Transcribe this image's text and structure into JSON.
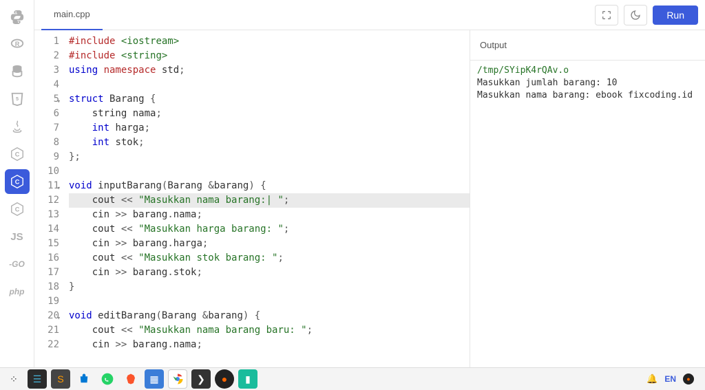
{
  "tab_filename": "main.cpp",
  "run_label": "Run",
  "output_header": "Output",
  "output_path": "/tmp/SYipK4rQAv.o",
  "output_lines": [
    "Masukkan jumlah barang: 10",
    "Masukkan nama barang: ebook fixcoding.id"
  ],
  "highlighted_line": 12,
  "code_lines": [
    {
      "n": 1,
      "fold": false,
      "tokens": [
        {
          "t": "#include",
          "c": "kw-red"
        },
        {
          "t": " "
        },
        {
          "t": "<iostream>",
          "c": "kw-green"
        }
      ]
    },
    {
      "n": 2,
      "fold": false,
      "tokens": [
        {
          "t": "#include",
          "c": "kw-red"
        },
        {
          "t": " "
        },
        {
          "t": "<string>",
          "c": "kw-green"
        }
      ]
    },
    {
      "n": 3,
      "fold": false,
      "tokens": [
        {
          "t": "using ",
          "c": "kw-blue"
        },
        {
          "t": "namespace ",
          "c": "kw-red"
        },
        {
          "t": "std"
        },
        {
          "t": ";",
          "c": "op"
        }
      ]
    },
    {
      "n": 4,
      "fold": false,
      "tokens": [
        {
          "t": " "
        }
      ]
    },
    {
      "n": 5,
      "fold": true,
      "tokens": [
        {
          "t": "struct ",
          "c": "kw-blue"
        },
        {
          "t": "Barang "
        },
        {
          "t": "{",
          "c": "op"
        }
      ]
    },
    {
      "n": 6,
      "fold": false,
      "tokens": [
        {
          "t": "    string nama"
        },
        {
          "t": ";",
          "c": "op"
        }
      ]
    },
    {
      "n": 7,
      "fold": false,
      "tokens": [
        {
          "t": "    "
        },
        {
          "t": "int ",
          "c": "kw-blue"
        },
        {
          "t": "harga"
        },
        {
          "t": ";",
          "c": "op"
        }
      ]
    },
    {
      "n": 8,
      "fold": false,
      "tokens": [
        {
          "t": "    "
        },
        {
          "t": "int ",
          "c": "kw-blue"
        },
        {
          "t": "stok"
        },
        {
          "t": ";",
          "c": "op"
        }
      ]
    },
    {
      "n": 9,
      "fold": false,
      "tokens": [
        {
          "t": "};",
          "c": "op"
        }
      ]
    },
    {
      "n": 10,
      "fold": false,
      "tokens": [
        {
          "t": " "
        }
      ]
    },
    {
      "n": 11,
      "fold": true,
      "tokens": [
        {
          "t": "void ",
          "c": "kw-blue"
        },
        {
          "t": "inputBarang"
        },
        {
          "t": "(",
          "c": "op"
        },
        {
          "t": "Barang "
        },
        {
          "t": "&",
          "c": "op"
        },
        {
          "t": "barang"
        },
        {
          "t": ") {",
          "c": "op"
        }
      ]
    },
    {
      "n": 12,
      "fold": false,
      "tokens": [
        {
          "t": "    cout "
        },
        {
          "t": "<<",
          "c": "op"
        },
        {
          "t": " "
        },
        {
          "t": "\"Masukkan nama barang:| \"",
          "c": "str"
        },
        {
          "t": ";",
          "c": "op"
        }
      ]
    },
    {
      "n": 13,
      "fold": false,
      "tokens": [
        {
          "t": "    cin "
        },
        {
          "t": ">>",
          "c": "op"
        },
        {
          "t": " barang"
        },
        {
          "t": ".",
          "c": "op"
        },
        {
          "t": "nama"
        },
        {
          "t": ";",
          "c": "op"
        }
      ]
    },
    {
      "n": 14,
      "fold": false,
      "tokens": [
        {
          "t": "    cout "
        },
        {
          "t": "<<",
          "c": "op"
        },
        {
          "t": " "
        },
        {
          "t": "\"Masukkan harga barang: \"",
          "c": "str"
        },
        {
          "t": ";",
          "c": "op"
        }
      ]
    },
    {
      "n": 15,
      "fold": false,
      "tokens": [
        {
          "t": "    cin "
        },
        {
          "t": ">>",
          "c": "op"
        },
        {
          "t": " barang"
        },
        {
          "t": ".",
          "c": "op"
        },
        {
          "t": "harga"
        },
        {
          "t": ";",
          "c": "op"
        }
      ]
    },
    {
      "n": 16,
      "fold": false,
      "tokens": [
        {
          "t": "    cout "
        },
        {
          "t": "<<",
          "c": "op"
        },
        {
          "t": " "
        },
        {
          "t": "\"Masukkan stok barang: \"",
          "c": "str"
        },
        {
          "t": ";",
          "c": "op"
        }
      ]
    },
    {
      "n": 17,
      "fold": false,
      "tokens": [
        {
          "t": "    cin "
        },
        {
          "t": ">>",
          "c": "op"
        },
        {
          "t": " barang"
        },
        {
          "t": ".",
          "c": "op"
        },
        {
          "t": "stok"
        },
        {
          "t": ";",
          "c": "op"
        }
      ]
    },
    {
      "n": 18,
      "fold": false,
      "tokens": [
        {
          "t": "}",
          "c": "op"
        }
      ]
    },
    {
      "n": 19,
      "fold": false,
      "tokens": [
        {
          "t": " "
        }
      ]
    },
    {
      "n": 20,
      "fold": true,
      "tokens": [
        {
          "t": "void ",
          "c": "kw-blue"
        },
        {
          "t": "editBarang"
        },
        {
          "t": "(",
          "c": "op"
        },
        {
          "t": "Barang "
        },
        {
          "t": "&",
          "c": "op"
        },
        {
          "t": "barang"
        },
        {
          "t": ") {",
          "c": "op"
        }
      ]
    },
    {
      "n": 21,
      "fold": false,
      "tokens": [
        {
          "t": "    cout "
        },
        {
          "t": "<<",
          "c": "op"
        },
        {
          "t": " "
        },
        {
          "t": "\"Masukkan nama barang baru: \"",
          "c": "str"
        },
        {
          "t": ";",
          "c": "op"
        }
      ]
    },
    {
      "n": 22,
      "fold": false,
      "tokens": [
        {
          "t": "    cin "
        },
        {
          "t": ">>",
          "c": "op"
        },
        {
          "t": " barang"
        },
        {
          "t": ".",
          "c": "op"
        },
        {
          "t": "nama"
        },
        {
          "t": ";",
          "c": "op"
        }
      ]
    }
  ],
  "sidebar_langs": [
    "python",
    "r",
    "db",
    "html",
    "java",
    "c",
    "csharp",
    "c2",
    "js",
    "go",
    "php"
  ],
  "active_sidebar_index": 6,
  "taskbar": {
    "lang_indicator": "EN"
  }
}
